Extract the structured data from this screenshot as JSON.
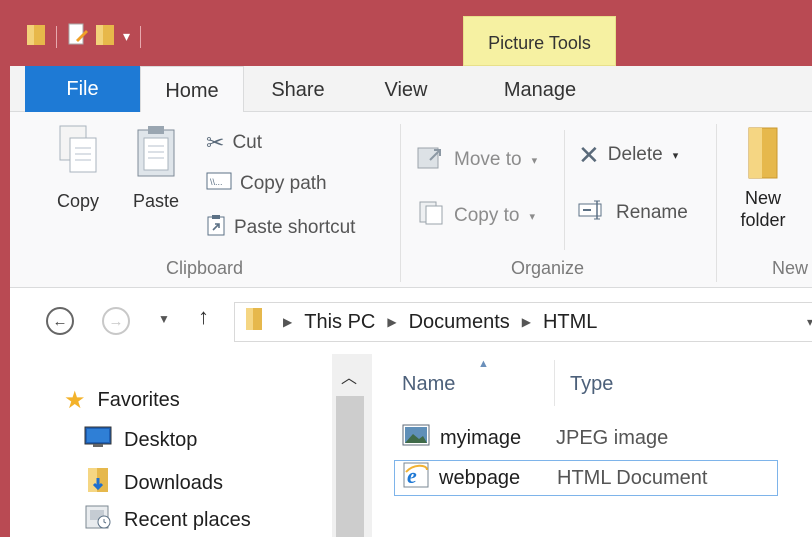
{
  "titlebar": {
    "context_tab": "Picture Tools"
  },
  "tabs": {
    "file": "File",
    "home": "Home",
    "share": "Share",
    "view": "View",
    "manage": "Manage"
  },
  "ribbon": {
    "clipboard": {
      "label": "Clipboard",
      "copy": "Copy",
      "paste": "Paste",
      "cut": "Cut",
      "copy_path": "Copy path",
      "paste_shortcut": "Paste shortcut"
    },
    "organize": {
      "label": "Organize",
      "move_to": "Move to",
      "copy_to": "Copy to",
      "delete": "Delete",
      "rename": "Rename"
    },
    "new": {
      "label": "New",
      "new_folder_line1": "New",
      "new_folder_line2": "folder"
    }
  },
  "address": {
    "crumbs": [
      "This PC",
      "Documents",
      "HTML"
    ]
  },
  "navpane": {
    "favorites": "Favorites",
    "items": [
      "Desktop",
      "Downloads",
      "Recent places"
    ]
  },
  "filelist": {
    "columns": [
      "Name",
      "Type"
    ],
    "rows": [
      {
        "name": "myimage",
        "type": "JPEG image",
        "icon": "image-file-icon"
      },
      {
        "name": "webpage",
        "type": "HTML Document",
        "icon": "ie-html-file-icon"
      }
    ]
  },
  "colors": {
    "titlebar": "#b94a53",
    "file_tab": "#1e7ad5",
    "context_tab": "#f6f1a2",
    "selection_border": "#7eb4ea"
  }
}
